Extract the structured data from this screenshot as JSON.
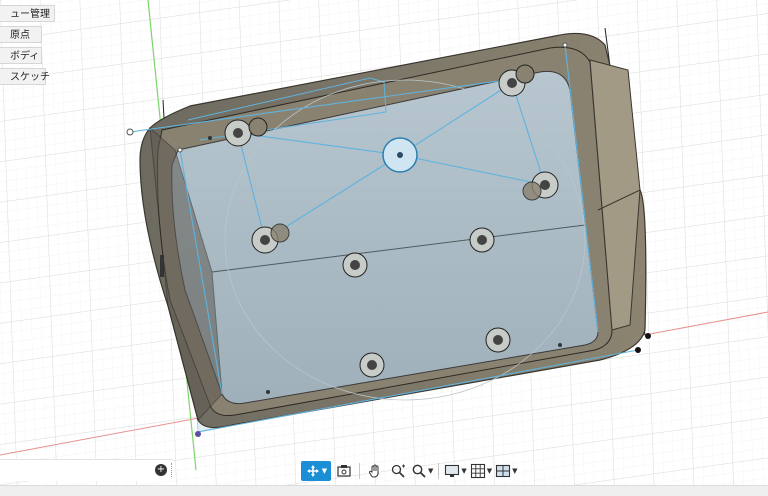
{
  "browser": {
    "items": [
      {
        "label": "ュー管理",
        "name": "browser-item-named-views"
      },
      {
        "label": "原点",
        "name": "browser-item-origin"
      },
      {
        "label": "ボディ",
        "name": "browser-item-bodies"
      },
      {
        "label": "スケッチ",
        "name": "browser-item-sketches"
      }
    ]
  },
  "timeline": {
    "add_label": "+"
  },
  "toolbar": {
    "items": [
      {
        "name": "orbit-tool-button",
        "icon": "orbit-icon",
        "active": true,
        "has_menu": true
      },
      {
        "name": "look-at-button",
        "icon": "look-at-icon",
        "active": false,
        "has_menu": false
      },
      {
        "name": "pan-button",
        "icon": "hand-icon",
        "active": false,
        "has_menu": false
      },
      {
        "name": "zoom-window-button",
        "icon": "zoom-plus-icon",
        "active": false,
        "has_menu": false
      },
      {
        "name": "fit-button",
        "icon": "magnifier-icon",
        "active": false,
        "has_menu": true
      },
      {
        "name": "display-settings-button",
        "icon": "monitor-icon",
        "active": false,
        "has_menu": true
      },
      {
        "name": "grid-settings-button",
        "icon": "grid-icon",
        "active": false,
        "has_menu": true
      },
      {
        "name": "viewports-button",
        "icon": "viewports-icon",
        "active": false,
        "has_menu": true
      }
    ]
  },
  "colors": {
    "accent": "#1a8fd6",
    "sketch_line": "#5fb3df",
    "body_shell": "#7b7360",
    "grid": "#dcdcdc"
  }
}
